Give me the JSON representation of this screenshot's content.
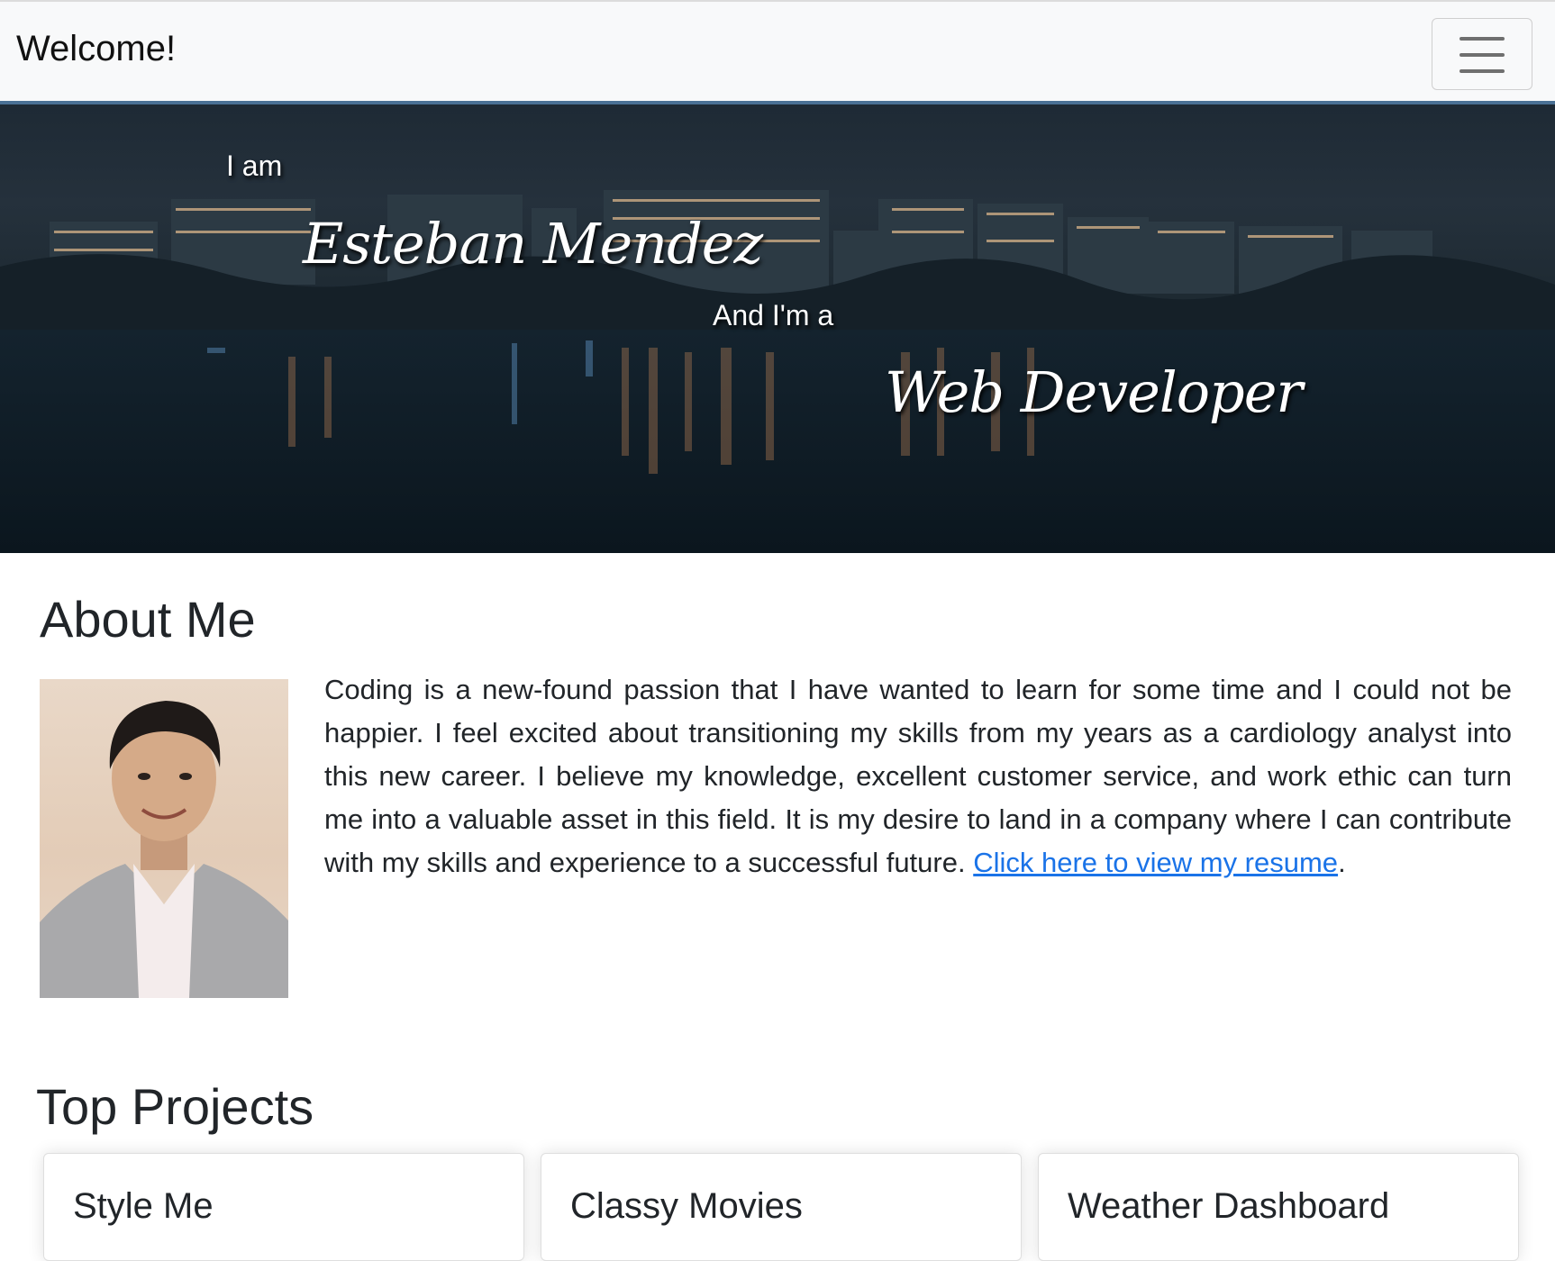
{
  "navbar": {
    "brand": "Welcome!",
    "toggle_icon": "hamburger-menu-icon"
  },
  "hero": {
    "line1": "I am",
    "name": "Esteban Mendez",
    "line2": "And I'm a",
    "role": "Web Developer"
  },
  "about": {
    "title": "About Me",
    "photo": "profile-photo",
    "text": "Coding is a new-found passion that I have wanted to learn for some time and I could not be happier. I feel excited about transitioning my skills from my years as a cardiology analyst into this new career. I believe my knowledge, excellent customer service, and work ethic can turn me into a valuable asset in this field. It is my desire to land in a company where I can contribute with my skills and experience to a successful future.",
    "link_text": "Click here to view my resume",
    "trailing": "."
  },
  "projects": {
    "title": "Top Projects",
    "cards": [
      {
        "title": "Style Me"
      },
      {
        "title": "Classy Movies"
      },
      {
        "title": "Weather Dashboard"
      }
    ]
  },
  "colors": {
    "link": "#1a73e8",
    "navbar_border": "#4a7195",
    "navbar_bg": "#f8f9fa"
  }
}
